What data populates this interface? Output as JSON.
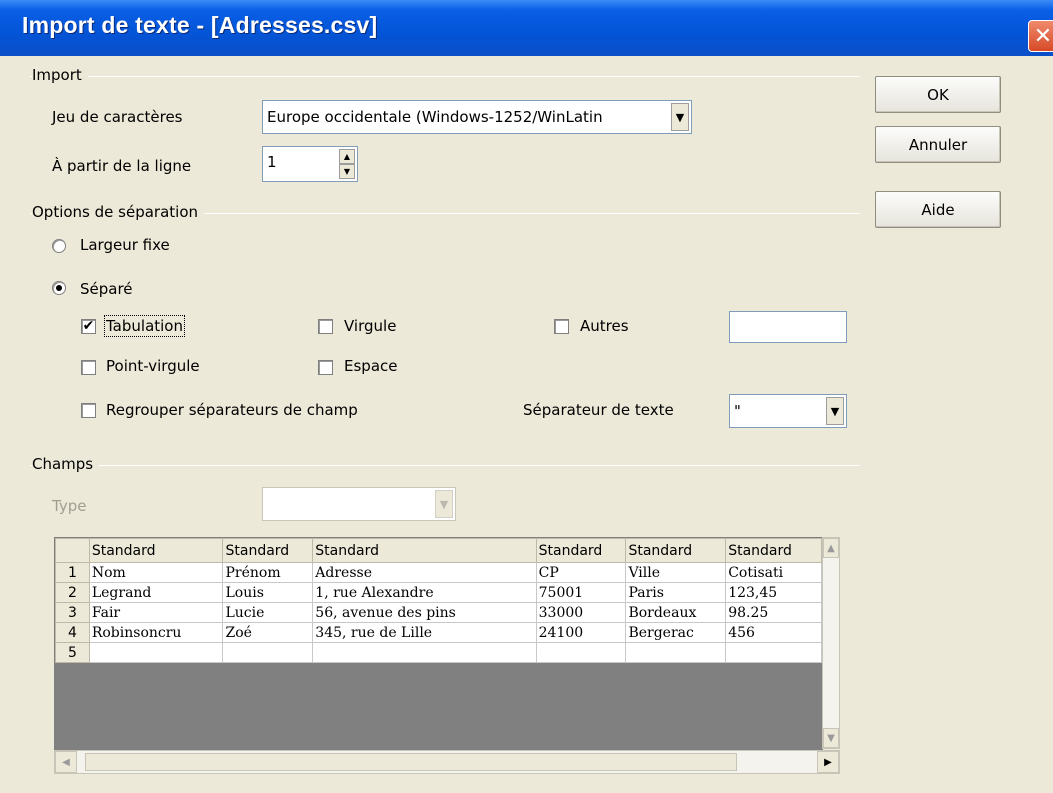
{
  "window": {
    "title": "Import de texte - [Adresses.csv]",
    "close_glyph": "✕"
  },
  "buttons": {
    "ok": "OK",
    "cancel": "Annuler",
    "help": "Aide"
  },
  "import": {
    "group_label": "Import",
    "charset_label": "Jeu de caractères",
    "charset_value": "Europe occidentale (Windows-1252/WinLatin",
    "from_line_label": "À partir de la ligne",
    "from_line_value": "1"
  },
  "separation": {
    "group_label": "Options de séparation",
    "fixed_width_label": "Largeur fixe",
    "fixed_width_checked": false,
    "separated_label": "Séparé",
    "separated_checked": true,
    "tab_label": "Tabulation",
    "tab_checked": true,
    "comma_label": "Virgule",
    "comma_checked": false,
    "other_label": "Autres",
    "other_checked": false,
    "other_value": "",
    "semicolon_label": "Point-virgule",
    "semicolon_checked": false,
    "space_label": "Espace",
    "space_checked": false,
    "merge_label": "Regrouper séparateurs de champ",
    "merge_checked": false,
    "text_delim_label": "Séparateur de texte",
    "text_delim_value": "\""
  },
  "fields": {
    "group_label": "Champs",
    "type_label": "Type",
    "type_value": "",
    "column_types": [
      "Standard",
      "Standard",
      "Standard",
      "Standard",
      "Standard",
      "Standard"
    ],
    "rows": [
      {
        "num": "1",
        "cells": [
          "Nom",
          "Prénom",
          "Adresse",
          "CP",
          "Ville",
          "Cotisati"
        ]
      },
      {
        "num": "2",
        "cells": [
          "Legrand",
          "Louis",
          "1, rue Alexandre",
          "75001",
          "Paris",
          "123,45"
        ]
      },
      {
        "num": "3",
        "cells": [
          "Fair",
          "Lucie",
          "56, avenue des pins",
          "33000",
          "Bordeaux",
          "98.25"
        ]
      },
      {
        "num": "4",
        "cells": [
          "Robinsoncru",
          "Zoé",
          "345, rue de Lille",
          "24100",
          "Bergerac",
          "456"
        ]
      },
      {
        "num": "5",
        "cells": [
          "",
          "",
          "",
          "",
          "",
          ""
        ]
      }
    ]
  },
  "icons": {
    "check_glyph": "✔",
    "dropdown_glyph": "▼",
    "spin_up_glyph": "▲",
    "spin_down_glyph": "▼",
    "scroll_up_glyph": "▲",
    "scroll_down_glyph": "▼",
    "scroll_left_glyph": "◀",
    "scroll_right_glyph": "▶"
  }
}
